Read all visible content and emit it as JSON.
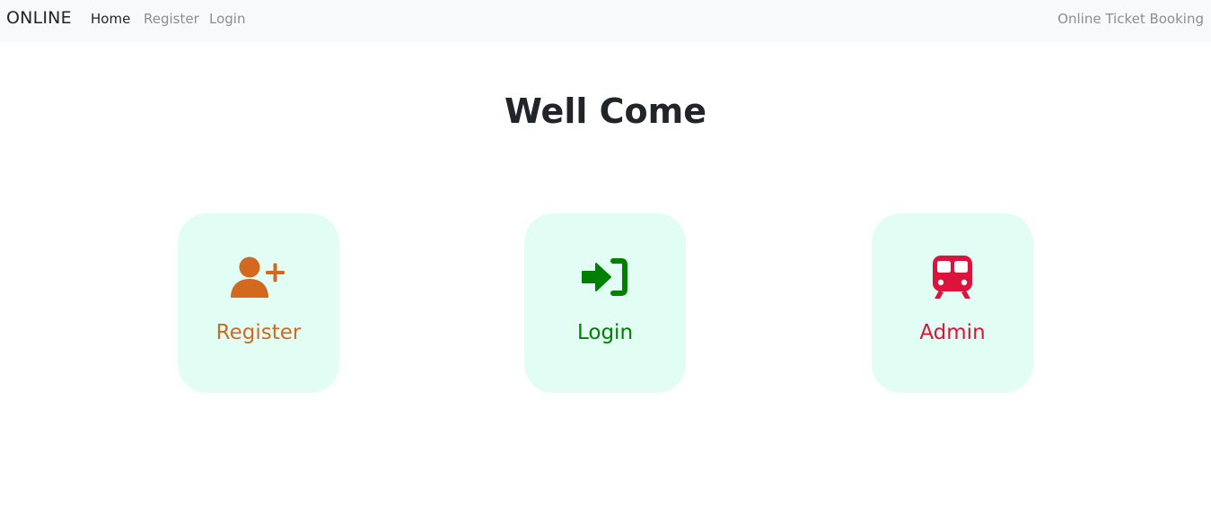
{
  "navbar": {
    "brand": "ONLINE",
    "links": [
      {
        "label": "Home",
        "active": true
      },
      {
        "label": "Register",
        "active": false
      },
      {
        "label": "Login",
        "active": false
      }
    ],
    "right_text": "Online Ticket Booking"
  },
  "main": {
    "title": "Well Come",
    "cards": [
      {
        "label": "Register",
        "icon": "user-plus-icon",
        "color": "#d2691e"
      },
      {
        "label": "Login",
        "icon": "sign-in-icon",
        "color": "#008000"
      },
      {
        "label": "Admin",
        "icon": "train-icon",
        "color": "#dc143c"
      }
    ],
    "card_background": "#e2fdf4"
  }
}
